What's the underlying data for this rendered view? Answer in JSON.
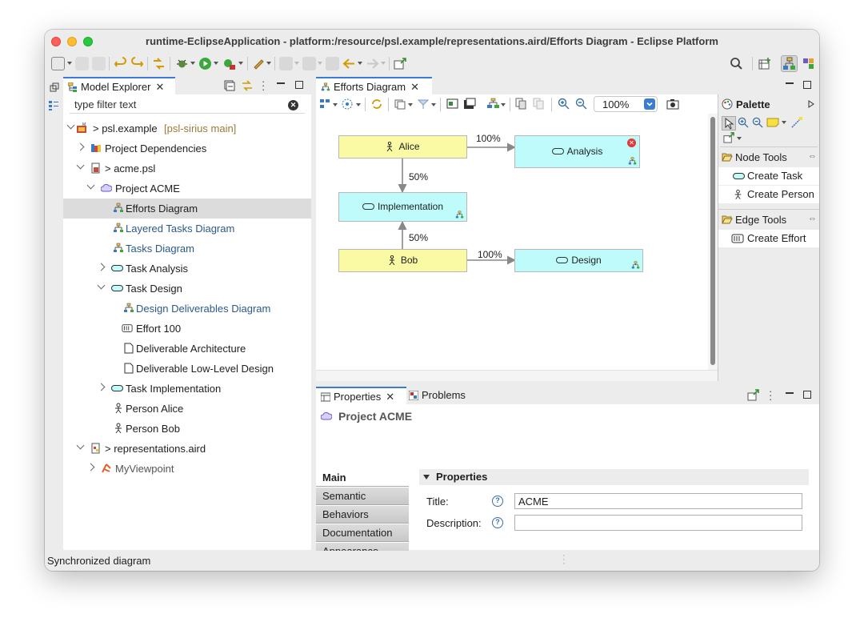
{
  "window": {
    "title": "runtime-EclipseApplication - platform:/resource/psl.example/representations.aird/Efforts Diagram - Eclipse Platform"
  },
  "model_explorer": {
    "tab_label": "Model Explorer",
    "filter_placeholder": "type filter text",
    "tree": [
      {
        "label": "> psl.example",
        "suffix": "[psl-sirius main]"
      },
      {
        "label": "Project Dependencies"
      },
      {
        "label": "> acme.psl"
      },
      {
        "label": "Project ACME"
      },
      {
        "label": "Efforts Diagram"
      },
      {
        "label": "Layered Tasks Diagram"
      },
      {
        "label": "Tasks Diagram"
      },
      {
        "label": "Task Analysis"
      },
      {
        "label": "Task Design"
      },
      {
        "label": "Design Deliverables Diagram"
      },
      {
        "label": "Effort 100"
      },
      {
        "label": "Deliverable Architecture"
      },
      {
        "label": "Deliverable Low-Level Design"
      },
      {
        "label": "Task Implementation"
      },
      {
        "label": "Person Alice"
      },
      {
        "label": "Person Bob"
      },
      {
        "label": "> representations.aird"
      },
      {
        "label": "MyViewpoint"
      }
    ]
  },
  "editor": {
    "tab_label": "Efforts Diagram",
    "zoom": "100%",
    "nodes": {
      "alice": "Alice",
      "analysis": "Analysis",
      "implementation": "Implementation",
      "bob": "Bob",
      "design": "Design"
    },
    "edges": {
      "alice_analysis": "100%",
      "alice_implementation": "50%",
      "bob_implementation": "50%",
      "bob_design": "100%"
    }
  },
  "palette": {
    "title": "Palette",
    "node_tools": "Node Tools",
    "create_task": "Create Task",
    "create_person": "Create Person",
    "edge_tools": "Edge Tools",
    "create_effort": "Create Effort"
  },
  "properties": {
    "tab_label": "Properties",
    "problems_tab_label": "Problems",
    "header": "Project ACME",
    "tabs": [
      "Main",
      "Semantic",
      "Behaviors",
      "Documentation",
      "Appearance"
    ],
    "section": "Properties",
    "title_label": "Title:",
    "title_value": "ACME",
    "description_label": "Description:",
    "description_value": ""
  },
  "status": {
    "text": "Synchronized diagram"
  },
  "colors": {
    "person_fill": "#fafaa5",
    "task_fill": "#c0fbfb",
    "accent": "#3a7bd5"
  }
}
